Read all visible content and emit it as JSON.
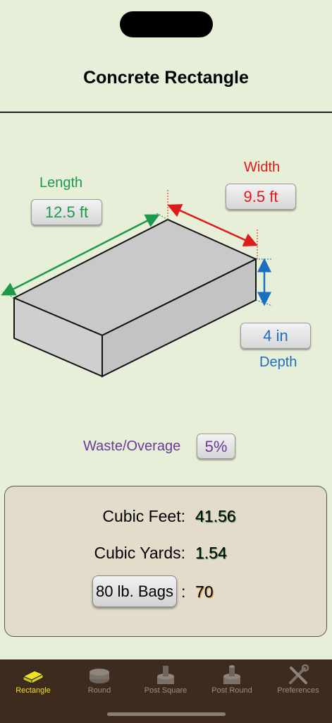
{
  "page": {
    "title": "Concrete Rectangle"
  },
  "dimensions": {
    "length": {
      "label": "Length",
      "value": "12.5  ft"
    },
    "width": {
      "label": "Width",
      "value": "9.5  ft"
    },
    "depth": {
      "label": "Depth",
      "value": "4  in"
    }
  },
  "waste": {
    "label": "Waste/Overage",
    "value": "5%"
  },
  "results": {
    "cubic_feet_label": "Cubic Feet:",
    "cubic_feet_value": "41.56",
    "cubic_yards_label": "Cubic Yards:",
    "cubic_yards_value": "1.54",
    "bags_button": "80 lb. Bags",
    "bags_separator": ":",
    "bags_value": "70"
  },
  "tabs": [
    {
      "label": "Rectangle",
      "icon": "rectangle-block-icon",
      "active": true
    },
    {
      "label": "Round",
      "icon": "round-slab-icon",
      "active": false
    },
    {
      "label": "Post Square",
      "icon": "post-square-icon",
      "active": false
    },
    {
      "label": "Post Round",
      "icon": "post-round-icon",
      "active": false
    },
    {
      "label": "Preferences",
      "icon": "tools-icon",
      "active": false
    }
  ],
  "colors": {
    "background": "#e7efd8",
    "length": "#1a9a4a",
    "width": "#e01a1a",
    "depth": "#1a6fbf",
    "waste": "#6a3a9a",
    "tabbar": "#3d2c1d",
    "active_tab": "#f0e020"
  }
}
